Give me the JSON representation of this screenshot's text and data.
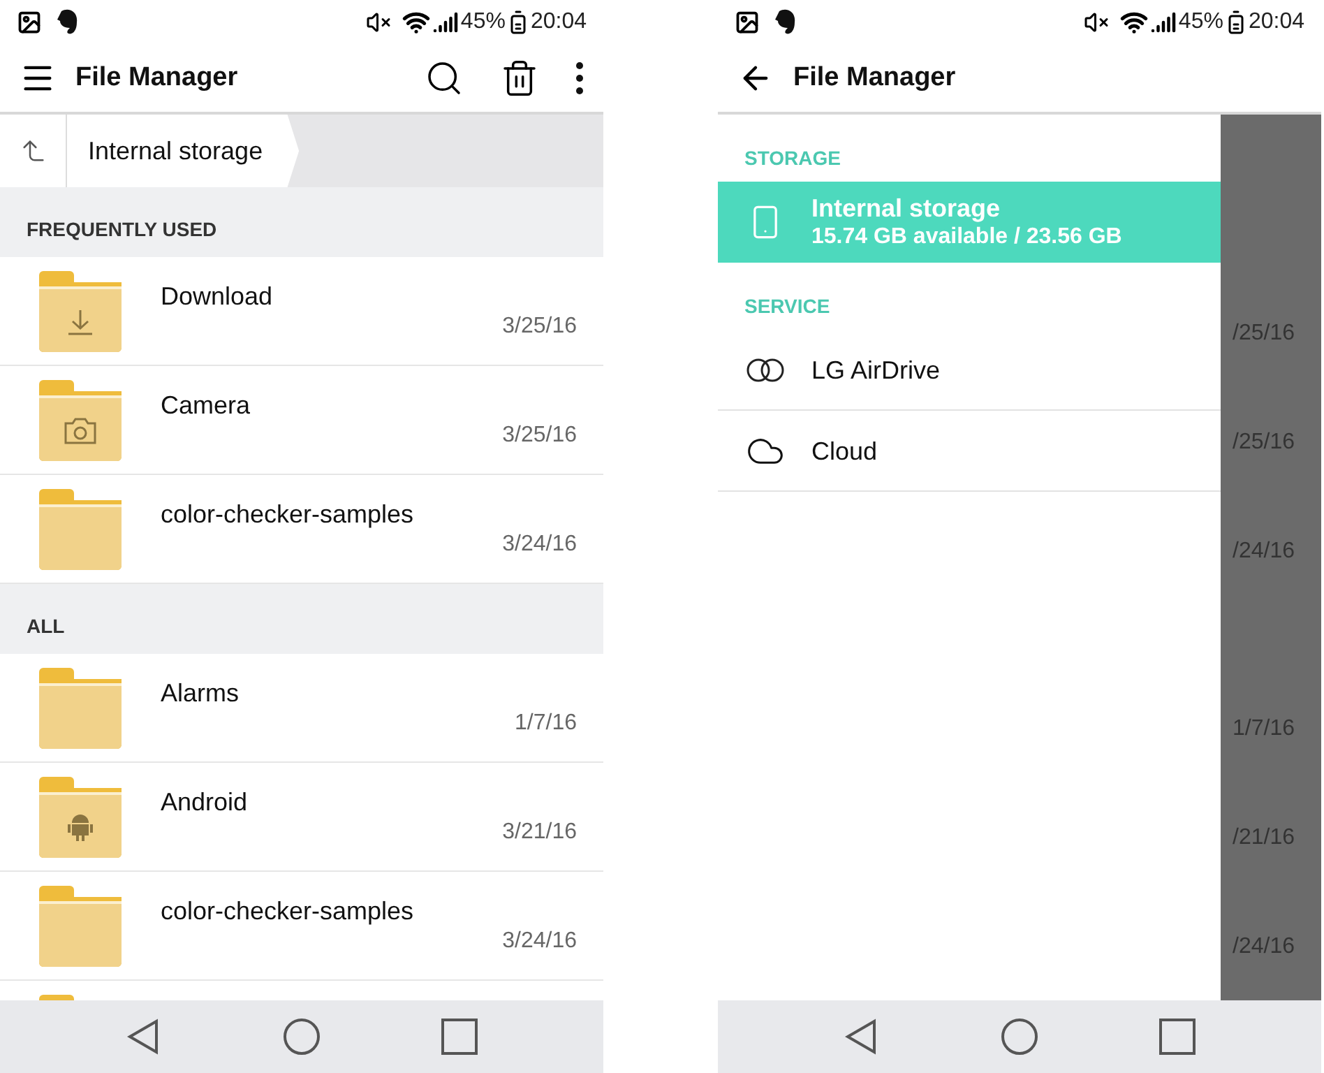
{
  "file_list_screen": {
    "status_bar": {
      "battery": "45%",
      "time": "20:04"
    },
    "toolbar": {
      "title": "File Manager"
    },
    "breadcrumb": {
      "label": "Internal storage"
    },
    "sections": [
      {
        "header": "FREQUENTLY USED",
        "items": [
          {
            "name": "Download",
            "date": "3/25/16",
            "kind": "download"
          },
          {
            "name": "Camera",
            "date": "3/25/16",
            "kind": "camera"
          },
          {
            "name": "color-checker-samples",
            "date": "3/24/16",
            "kind": "plain"
          }
        ]
      },
      {
        "header": "ALL",
        "items": [
          {
            "name": "Alarms",
            "date": "1/7/16",
            "kind": "plain"
          },
          {
            "name": "Android",
            "date": "3/21/16",
            "kind": "android"
          },
          {
            "name": "color-checker-samples",
            "date": "3/24/16",
            "kind": "plain"
          }
        ]
      }
    ]
  },
  "drawer_screen": {
    "status_bar": {
      "battery": "45%",
      "time": "20:04"
    },
    "toolbar": {
      "title": "File Manager"
    },
    "sections": [
      {
        "header": "STORAGE",
        "items": [
          {
            "kind": "storage",
            "title": "Internal storage",
            "subtitle": "15.74 GB available / 23.56 GB",
            "selected": true
          }
        ]
      },
      {
        "header": "SERVICE",
        "items": [
          {
            "kind": "rings",
            "title": "LG AirDrive",
            "selected": false
          },
          {
            "kind": "cloud",
            "title": "Cloud",
            "selected": false
          }
        ]
      }
    ],
    "dimmed_dates": [
      "/25/16",
      "/25/16",
      "/24/16",
      "1/7/16",
      "/21/16",
      "/24/16"
    ]
  }
}
